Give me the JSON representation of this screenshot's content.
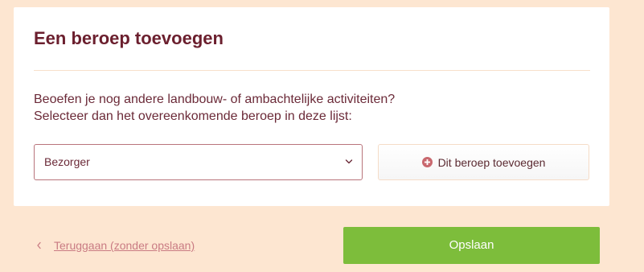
{
  "page": {
    "title": "Een beroep toevoegen",
    "question_line1": "Beoefen je nog andere landbouw- of ambachtelijke activiteiten?",
    "question_line2": "Selecteer dan het overeenkomende beroep in deze lijst:"
  },
  "select": {
    "value": "Bezorger",
    "icon": "chevron-down-icon"
  },
  "add_button": {
    "label": "Dit beroep toevoegen",
    "icon": "plus-circle-icon"
  },
  "footer": {
    "back_label": "Teruggaan (zonder opslaan)",
    "back_icon": "chevron-left-icon",
    "save_label": "Opslaan"
  },
  "colors": {
    "background": "#fde6d1",
    "title": "#6b1f2e",
    "text": "#6b2a38",
    "link": "#c97b83",
    "accent_icon": "#c9686e",
    "save_button": "#7dbd3b"
  }
}
